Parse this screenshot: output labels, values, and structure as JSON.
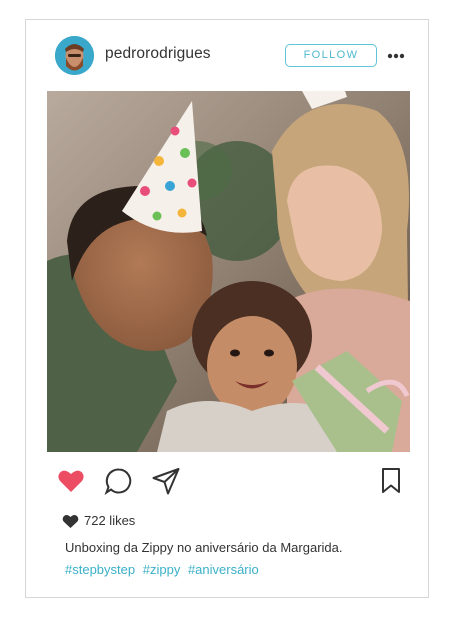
{
  "post": {
    "username": "pedrorodrigues",
    "follow_label": "FOLLOW",
    "photo_alt": "",
    "likes_text": "722 likes",
    "caption": "Unboxing da Zippy no aniversário da Margarida.",
    "hashtags": [
      "#stepbystep",
      "#zippy",
      "#aniversário"
    ]
  },
  "icons": {
    "avatar": "avatar",
    "more": "more-dots-icon",
    "like": "heart-icon",
    "comment": "comment-icon",
    "share": "send-icon",
    "save": "bookmark-icon"
  },
  "colors": {
    "like_active": "#ec4d63",
    "follow_accent": "#4fb9cc",
    "hashtag": "#3bb0c8"
  },
  "state": {
    "liked": true
  }
}
